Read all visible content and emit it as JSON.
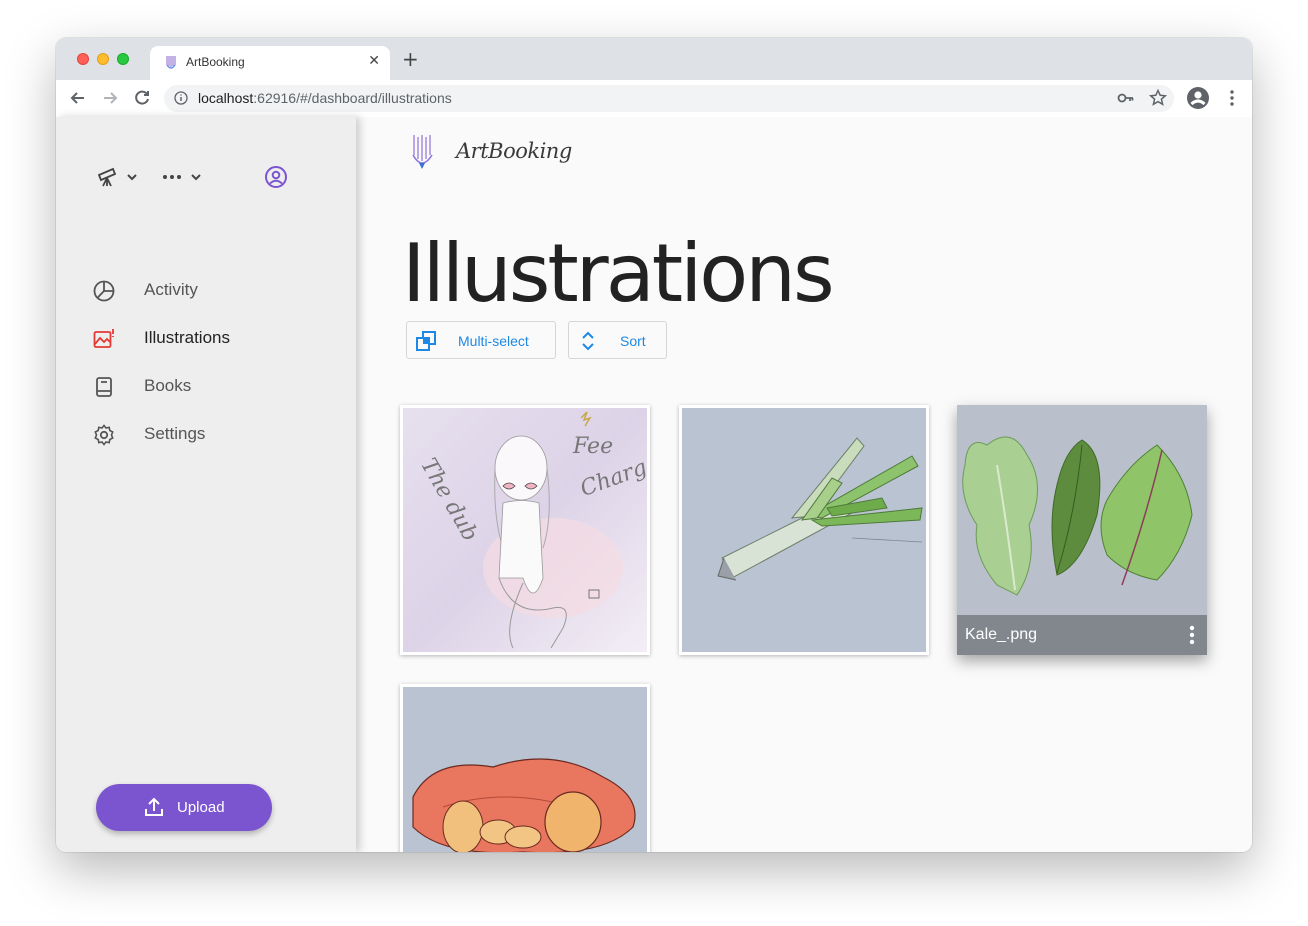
{
  "browser": {
    "tab_title": "ArtBooking",
    "tab_close": "✕",
    "new_tab": "+",
    "url_host": "localhost",
    "url_path": ":62916/#/dashboard/illustrations"
  },
  "sidebar": {
    "items": [
      {
        "label": "Activity",
        "icon": "pie-chart-icon"
      },
      {
        "label": "Illustrations",
        "icon": "image-icon",
        "active": true,
        "icon_color": "#e53935"
      },
      {
        "label": "Books",
        "icon": "book-icon"
      },
      {
        "label": "Settings",
        "icon": "gear-icon"
      }
    ],
    "upload_label": "Upload"
  },
  "main": {
    "brand": "ArtBooking",
    "title": "Illustrations",
    "multiselect_label": "Multi-select",
    "sort_label": "Sort",
    "cards": [
      {
        "name": "",
        "art": "girl-sketch"
      },
      {
        "name": "",
        "art": "leek"
      },
      {
        "name": "Kale_.png",
        "art": "kale",
        "hovered": true
      },
      {
        "name": "",
        "art": "sweet-potato"
      }
    ]
  },
  "colors": {
    "accent": "#7b55d0",
    "link_blue": "#1e88e5",
    "active_icon": "#e53935"
  }
}
